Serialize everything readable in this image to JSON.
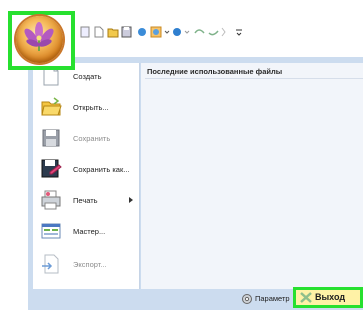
{
  "menu": {
    "recent_title": "Последние использованные файлы",
    "items": [
      {
        "label": "Создать",
        "mnemonic": "",
        "disabled": false,
        "icon": "new-document-icon"
      },
      {
        "label": "Открыть...",
        "mnemonic": "О",
        "disabled": false,
        "icon": "open-folder-icon"
      },
      {
        "label": "Сохранить",
        "mnemonic": "",
        "disabled": true,
        "icon": "save-icon"
      },
      {
        "label": "Сохранить как...",
        "mnemonic": "",
        "disabled": false,
        "icon": "save-as-icon"
      },
      {
        "label": "Печать",
        "mnemonic": "П",
        "disabled": false,
        "icon": "print-icon",
        "submenu": true
      },
      {
        "label": "Мастер...",
        "mnemonic": "М",
        "disabled": false,
        "icon": "wizard-icon"
      },
      {
        "label": "Экспорт...",
        "mnemonic": "",
        "disabled": true,
        "icon": "export-icon"
      }
    ]
  },
  "footer": {
    "options_label": "Параметр",
    "exit_label": "Выход"
  },
  "colors": {
    "highlight_frame": "#27e02f",
    "menu_frame": "#ccdcef",
    "exit_background": "#fff2a6"
  }
}
